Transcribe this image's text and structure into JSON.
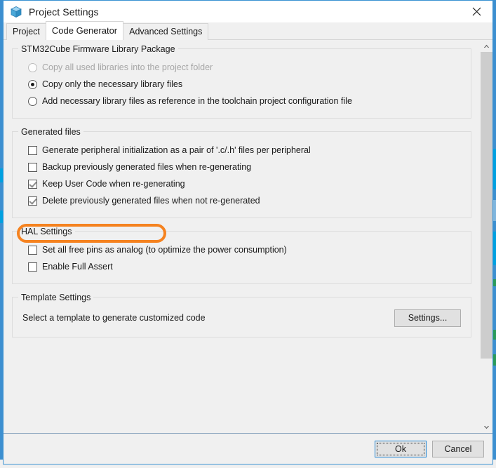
{
  "window": {
    "title": "Project Settings",
    "icon": "cube-icon",
    "close_label": "×"
  },
  "tabs": [
    {
      "label": "Project",
      "active": false
    },
    {
      "label": "Code Generator",
      "active": true
    },
    {
      "label": "Advanced Settings",
      "active": false
    }
  ],
  "groups": {
    "firmware": {
      "title": "STM32Cube Firmware Library Package",
      "options": [
        {
          "label": "Copy all used libraries into the project folder",
          "checked": false,
          "disabled": true
        },
        {
          "label": "Copy only the necessary library files",
          "checked": true,
          "disabled": false
        },
        {
          "label": "Add necessary library files as reference in the toolchain project configuration file",
          "checked": false,
          "disabled": false
        }
      ]
    },
    "generated": {
      "title": "Generated files",
      "options": [
        {
          "label": "Generate peripheral initialization as a pair of '.c/.h' files per peripheral",
          "checked": false
        },
        {
          "label": "Backup previously generated files when re-generating",
          "checked": false
        },
        {
          "label": "Keep User Code when re-generating",
          "checked": true
        },
        {
          "label": "Delete previously generated files when not re-generated",
          "checked": true
        }
      ]
    },
    "hal": {
      "title": "HAL Settings",
      "options": [
        {
          "label": "Set all free pins as analog (to optimize the power consumption)",
          "checked": false
        },
        {
          "label": "Enable Full Assert",
          "checked": false
        }
      ]
    },
    "template": {
      "title": "Template Settings",
      "description": "Select a template to generate customized code",
      "settings_button": "Settings..."
    }
  },
  "annotation": {
    "target": "Keep User Code when re-generating",
    "color": "#f5821f",
    "shape": "rounded-rect-outline"
  },
  "footer": {
    "ok_label": "Ok",
    "cancel_label": "Cancel"
  },
  "scrollbar": {
    "up_arrow": "▲",
    "down_arrow": "▼"
  }
}
